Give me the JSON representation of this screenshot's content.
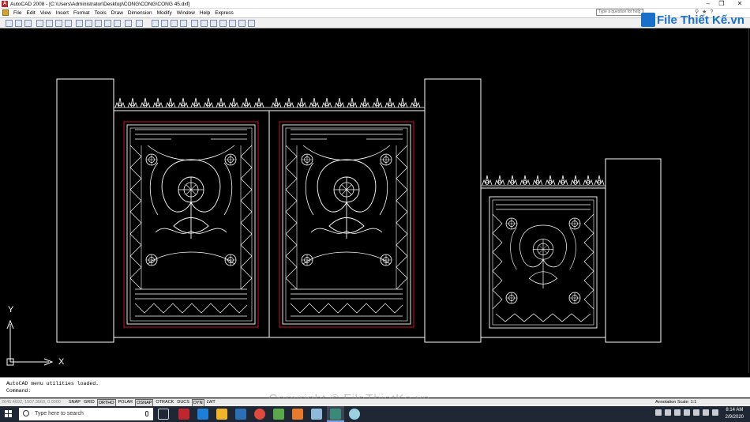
{
  "window": {
    "title": "AutoCAD 2008 - [C:\\Users\\Administrator\\Desktop\\CONG\\CONG\\CONG 45.dxf]",
    "app_icon": "A"
  },
  "menu": {
    "items": [
      "File",
      "Edit",
      "View",
      "Insert",
      "Format",
      "Tools",
      "Draw",
      "Dimension",
      "Modify",
      "Window",
      "Help",
      "Express"
    ]
  },
  "help_search": {
    "placeholder": "Type a question for help"
  },
  "logo": {
    "text": "File Thiết Kế.vn"
  },
  "ucs": {
    "x_label": "X",
    "y_label": "Y"
  },
  "command": {
    "history": "AutoCAD menu utilities loaded.",
    "prompt": "Command:"
  },
  "watermark": "Copyright © FileThietKe.vn",
  "status": {
    "coordinates": "2645.4692, 1507.3569, 0.0000",
    "buttons": [
      {
        "label": "SNAP",
        "on": false
      },
      {
        "label": "GRID",
        "on": false
      },
      {
        "label": "ORTHO",
        "on": true
      },
      {
        "label": "POLAR",
        "on": false
      },
      {
        "label": "OSNAP",
        "on": true
      },
      {
        "label": "OTRACK",
        "on": false
      },
      {
        "label": "DUCS",
        "on": false
      },
      {
        "label": "DYN",
        "on": true
      },
      {
        "label": "LWT",
        "on": false
      }
    ],
    "annotation_scale_label": "Annotation Scale:",
    "annotation_scale_value": "1:1"
  },
  "taskbar": {
    "search_placeholder": "Type here to search",
    "time": "8:14 AM",
    "date": "2/9/2020"
  },
  "colors": {
    "canvas": "#000000",
    "line": "#ffffff",
    "frame_red": "#c8102e",
    "taskbar": "#1f2734"
  }
}
